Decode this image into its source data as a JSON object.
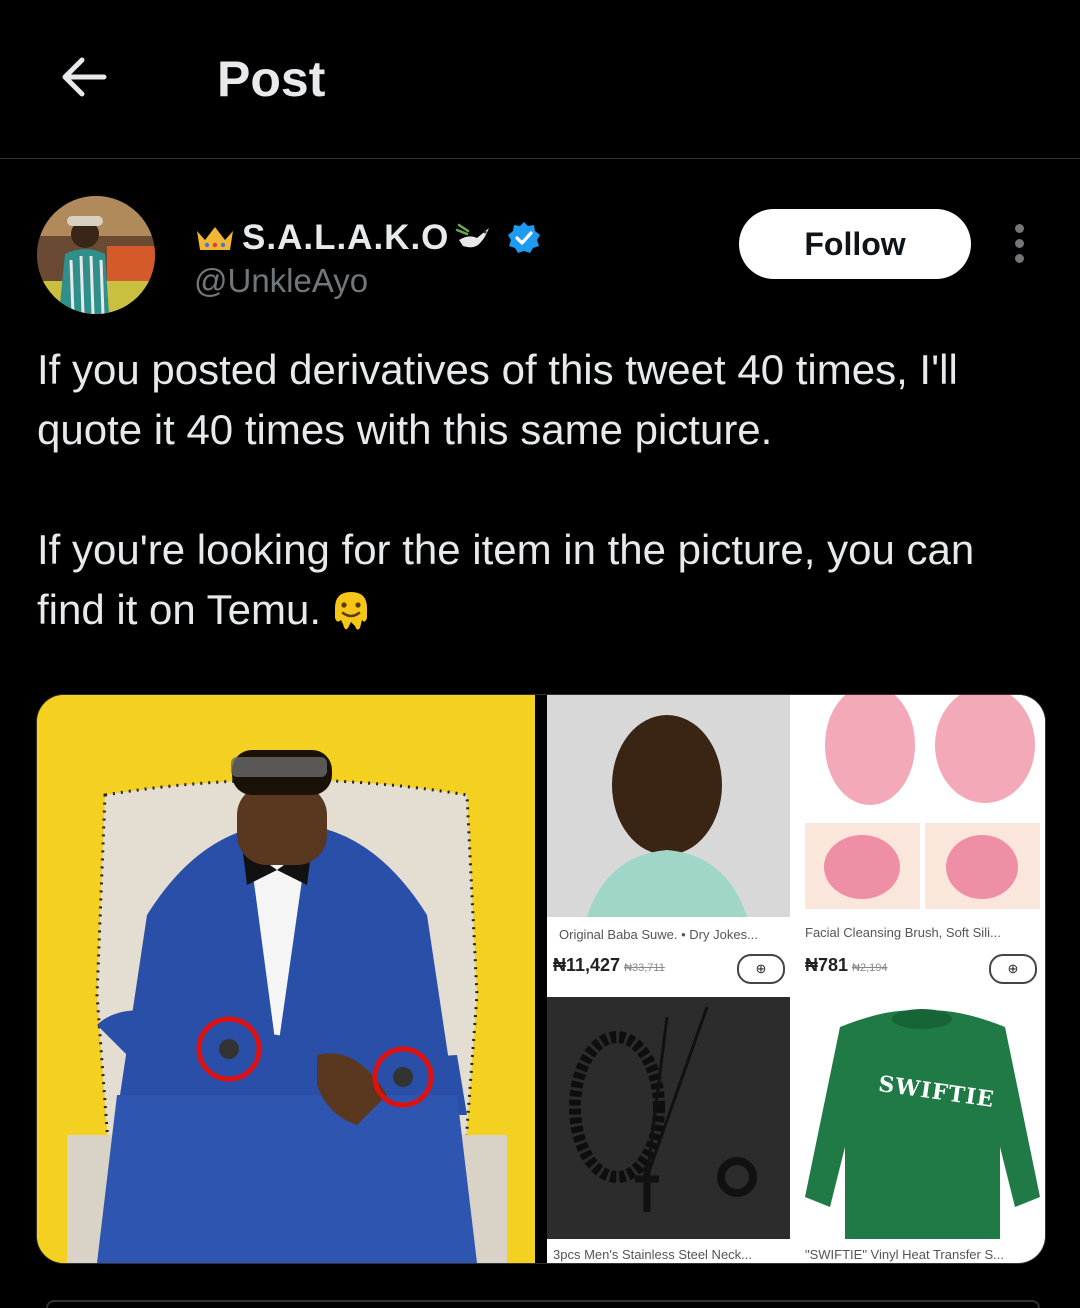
{
  "header": {
    "title": "Post"
  },
  "author": {
    "display_name": "S.A.L.A.K.O",
    "handle": "@UnkleAyo",
    "verified": true,
    "follow_label": "Follow"
  },
  "post": {
    "paragraphs": [
      "If you posted derivatives of this tweet 40 times, I'll quote it 40 times with this same picture.",
      "If you're looking for the item in the picture, you can find it on Temu."
    ]
  },
  "collage": {
    "items": [
      {
        "caption": "Original Baba Suwe. • Dry Jokes...",
        "price": "₦11,427",
        "old_price": "₦33,711"
      },
      {
        "caption": "Facial Cleansing Brush, Soft Sili...",
        "price": "₦781",
        "old_price": "₦2,194"
      },
      {
        "caption": "3pcs Men's Stainless Steel Neck..."
      },
      {
        "caption": "\"SWIFTIE\" Vinyl Heat Transfer S...",
        "shirt_text": "SWIFTIE"
      }
    ],
    "cart_symbol": "⊕"
  },
  "colors": {
    "background": "#000000",
    "text": "#e7e9ea",
    "muted": "#71767b",
    "verified": "#1d9bf0",
    "photo_bg": "#f4d020"
  }
}
